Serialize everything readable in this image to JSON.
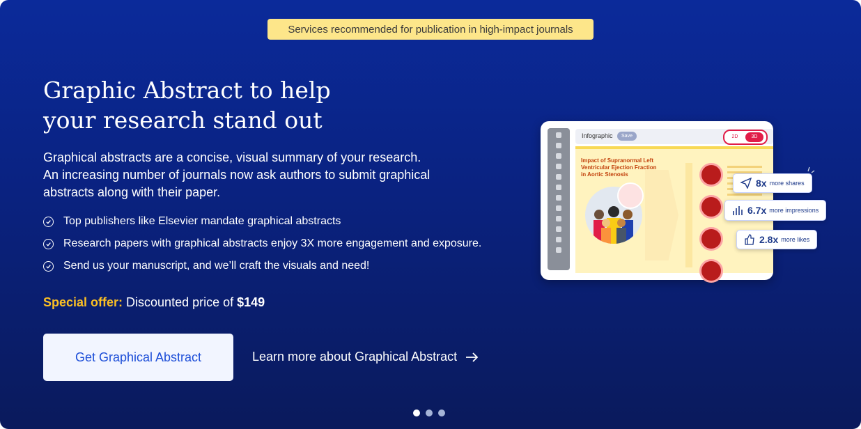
{
  "badge": "Services recommended for publication in high-impact journals",
  "headline": {
    "line1": "Graphic Abstract to help",
    "line2": "your research stand out"
  },
  "intro": {
    "line1": "Graphical abstracts are a concise, visual summary of your research.",
    "line2": "An increasing number of journals now ask authors to submit graphical",
    "line3": "abstracts along with their paper."
  },
  "bullets": [
    "Top publishers like Elsevier mandate graphical abstracts",
    "Research papers with graphical abstracts enjoy 3X more engagement and exposure.",
    "Send us your manuscript, and we’ll craft the visuals and need!"
  ],
  "offer": {
    "label": "Special offer:",
    "text": " Discounted price of ",
    "price": "$149"
  },
  "cta": {
    "primary": "Get Graphical Abstract",
    "secondary": "Learn more about Graphical Abstract"
  },
  "carousel": {
    "count": 3,
    "active": 1
  },
  "illustration": {
    "tab_label": "Infographic",
    "save_label": "Save",
    "toggle_2d": "2D",
    "toggle_3d": "3D",
    "canvas_title": "Impact of Supranormal Left Ventricular Ejection Fraction in Aortic Stenosis",
    "stats": [
      {
        "value": "8x",
        "label": "more shares",
        "icon": "send-icon"
      },
      {
        "value": "6.7x",
        "label": "more impressions",
        "icon": "bar-chart-icon"
      },
      {
        "value": "2.8x",
        "label": "more likes",
        "icon": "thumbs-up-icon"
      }
    ]
  },
  "colors": {
    "accent_yellow": "#fbbf24",
    "badge_bg": "#fde68a",
    "cta_text": "#1d4ed8",
    "bg_top": "#0b2a9a",
    "bg_bottom": "#0a1a5c"
  }
}
